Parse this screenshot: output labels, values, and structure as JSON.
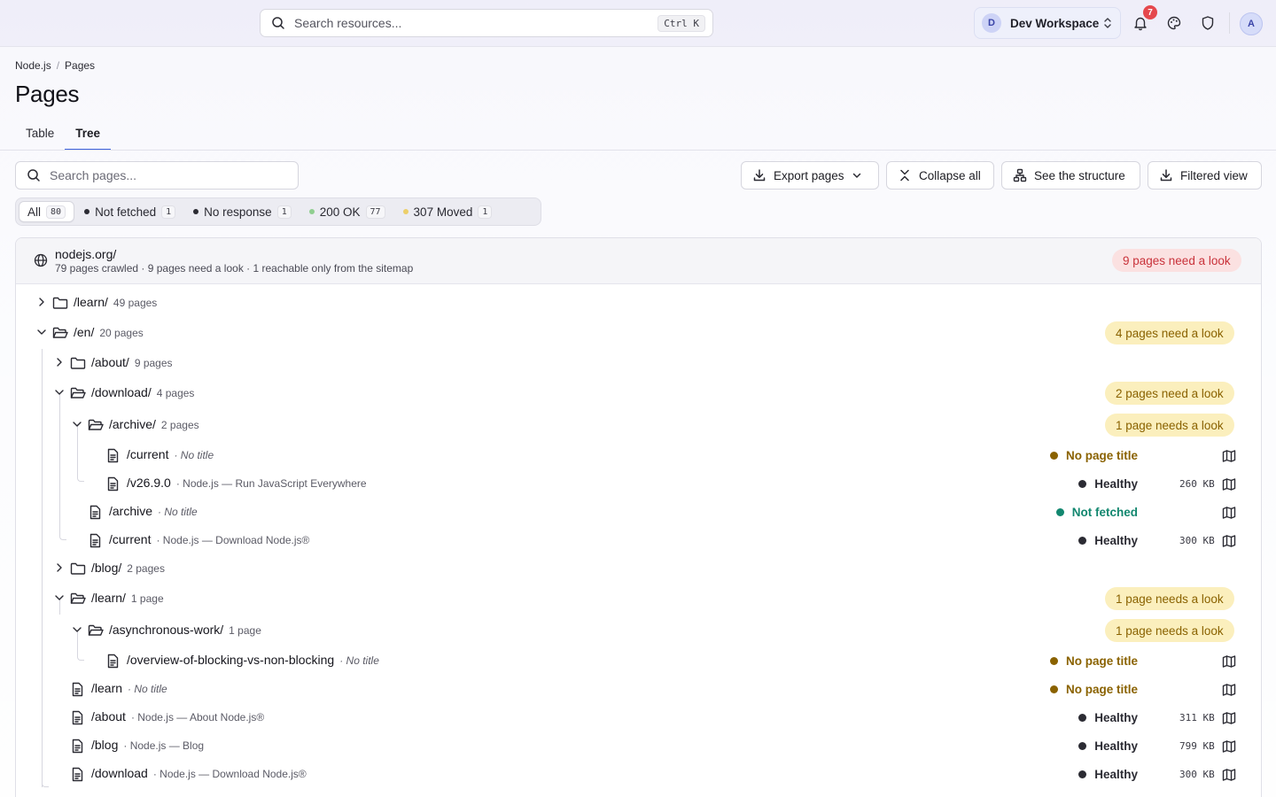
{
  "topbar": {
    "search_placeholder": "Search resources...",
    "search_shortcut": "Ctrl K",
    "workspace_initial": "D",
    "workspace_name": "Dev Workspace",
    "notification_count": "7",
    "user_initial": "A"
  },
  "breadcrumb": {
    "root": "Node.js",
    "sep": "/",
    "current": "Pages"
  },
  "page_title": "Pages",
  "tabs": [
    {
      "label": "Table"
    },
    {
      "label": "Tree"
    }
  ],
  "active_tab": "Tree",
  "toolbar": {
    "search_placeholder": "Search pages...",
    "export_label": "Export pages",
    "collapse_label": "Collapse all",
    "structure_label": "See the structure",
    "filtered_label": "Filtered view"
  },
  "filters": [
    {
      "label": "All",
      "count": "80",
      "color": ""
    },
    {
      "label": "Not fetched",
      "count": "1",
      "color": "#2b2b33"
    },
    {
      "label": "No response",
      "count": "1",
      "color": "#2b2b33"
    },
    {
      "label": "200 OK",
      "count": "77",
      "color": "#8fce8f"
    },
    {
      "label": "307 Moved",
      "count": "1",
      "color": "#eccf6a"
    }
  ],
  "site": {
    "domain": "nodejs.org/",
    "stats": "79 pages crawled · 9 pages need a look · 1 reachable only from the sitemap",
    "badge": "9 pages need a look"
  },
  "status_colors": {
    "No page title": "#8a6200",
    "Healthy": "#2b2b33",
    "Not fetched": "#12876f"
  },
  "tree": [
    {
      "path": "/learn/",
      "meta": "49 pages"
    },
    {
      "path": "/en/",
      "meta": "20 pages",
      "badge": "4 pages need a look"
    },
    {
      "path": "/about/",
      "meta": "9 pages"
    },
    {
      "path": "/download/",
      "meta": "4 pages",
      "badge": "2 pages need a look"
    },
    {
      "path": "/archive/",
      "meta": "2 pages",
      "badge": "1 page needs a look"
    },
    {
      "path": "/current",
      "meta": "· No title",
      "status": "No page title"
    },
    {
      "path": "/v26.9.0",
      "meta": "· Node.js — Run JavaScript Everywhere",
      "status": "Healthy",
      "size": "260 KB"
    },
    {
      "path": "/archive",
      "meta": "· No title",
      "status": "Not fetched"
    },
    {
      "path": "/current",
      "meta": "· Node.js — Download Node.js®",
      "status": "Healthy",
      "size": "300 KB"
    },
    {
      "path": "/blog/",
      "meta": "2 pages"
    },
    {
      "path": "/learn/",
      "meta": "1 page",
      "badge": "1 page needs a look"
    },
    {
      "path": "/asynchronous-work/",
      "meta": "1 page",
      "badge": "1 page needs a look"
    },
    {
      "path": "/overview-of-blocking-vs-non-blocking",
      "meta": "· No title",
      "status": "No page title"
    },
    {
      "path": "/learn",
      "meta": "· No title",
      "status": "No page title"
    },
    {
      "path": "/about",
      "meta": "· Node.js — About Node.js®",
      "status": "Healthy",
      "size": "311 KB"
    },
    {
      "path": "/blog",
      "meta": "· Node.js — Blog",
      "status": "Healthy",
      "size": "799 KB"
    },
    {
      "path": "/download",
      "meta": "· Node.js — Download Node.js®",
      "status": "Healthy",
      "size": "300 KB"
    }
  ]
}
